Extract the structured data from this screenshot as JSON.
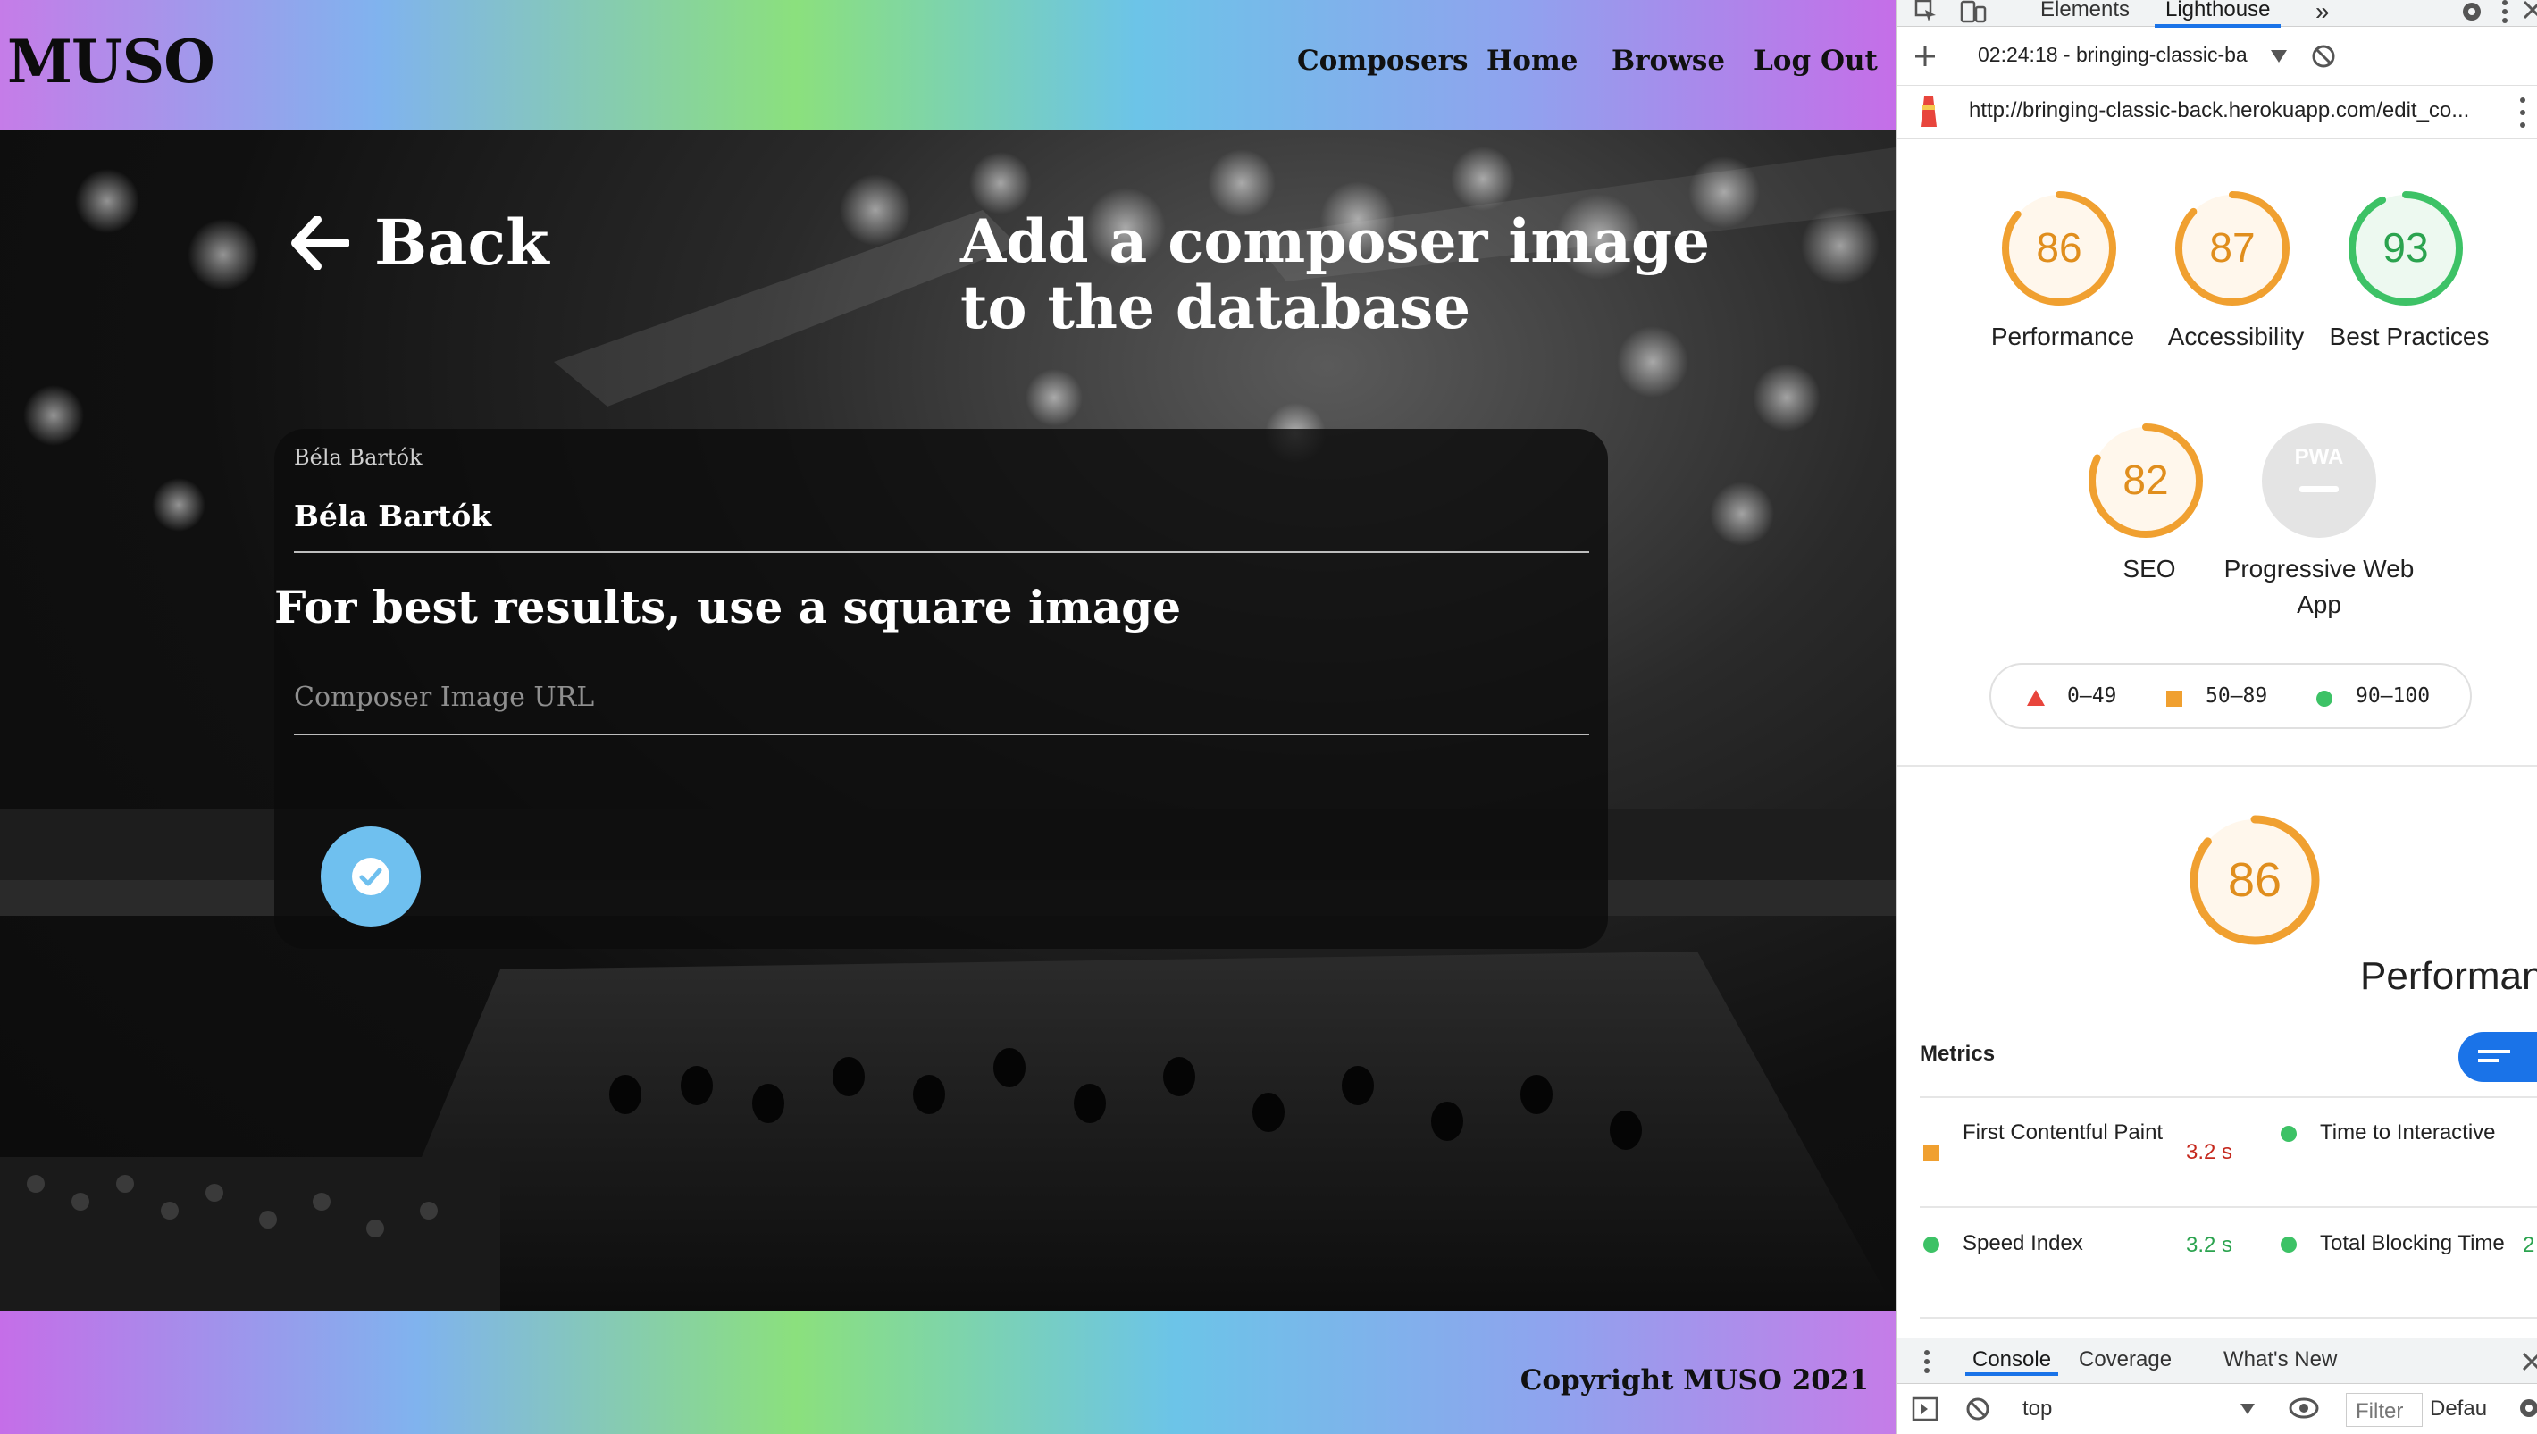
{
  "app": {
    "logo": "MUSO",
    "nav": [
      "Composers",
      "Home",
      "Browse",
      "Log Out"
    ],
    "back_label": "Back",
    "heading": "Add a composer image to the database",
    "form": {
      "name_label": "Béla Bartók",
      "name_value": "Béla Bartók",
      "hint": "For best results, use a square image",
      "url_placeholder": "Composer Image URL"
    },
    "footer": "Copyright MUSO 2021"
  },
  "devtools": {
    "tabs": [
      "Elements",
      "Lighthouse"
    ],
    "more_tabs_icon": "»",
    "report_select": "02:24:18 - bringing-classic-ba",
    "url": "http://bringing-classic-back.herokuapp.com/edit_co...",
    "scores": [
      {
        "label": "Performance",
        "score": 86,
        "color": "#f0a030"
      },
      {
        "label": "Accessibility",
        "score": 87,
        "color": "#f0a030"
      },
      {
        "label": "Best Practices",
        "score": 93,
        "color": "#3dc266"
      },
      {
        "label": "SEO",
        "score": 82,
        "color": "#f0a030"
      },
      {
        "label": "Progressive Web App",
        "score": "PWA",
        "color": "#9e9e9e"
      }
    ],
    "legend": [
      {
        "range": "0–49",
        "color": "#e8453c"
      },
      {
        "range": "50–89",
        "color": "#f0a030"
      },
      {
        "range": "90–100",
        "color": "#3dc266"
      }
    ],
    "perf_score": 86,
    "perf_title": "Performance",
    "metrics_title": "Metrics",
    "metrics": [
      {
        "name": "First Contentful Paint",
        "value": "3.2 s",
        "status": "average"
      },
      {
        "name": "Time to Interactive",
        "value": "",
        "status": "pass"
      },
      {
        "name": "Speed Index",
        "value": "3.2 s",
        "status": "pass"
      },
      {
        "name": "Total Blocking Time",
        "value": "2",
        "status": "pass"
      }
    ],
    "console_tabs": [
      "Console",
      "Coverage",
      "What's New"
    ],
    "context": "top",
    "filter_placeholder": "Filter",
    "levels": "Defau"
  }
}
